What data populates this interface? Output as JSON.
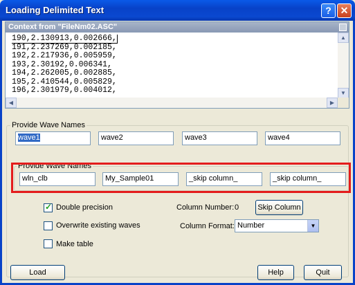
{
  "window": {
    "title": "Loading Delimited Text",
    "help_glyph": "?",
    "close_glyph": "✕"
  },
  "context": {
    "header": "Context from \"FileNm02.ASC\"",
    "lines": [
      "190,2.130913,0.002666,",
      "191,2.237269,0.002185,",
      "192,2.217936,0.005959,",
      "193,2.30192,0.006341,",
      "194,2.262005,0.002885,",
      "195,2.410544,0.005829,",
      "196,2.301979,0.004012,"
    ]
  },
  "wave_names_1": {
    "label": "Provide Wave Names",
    "fields": [
      "wave1",
      "wave2",
      "wave3",
      "wave4"
    ]
  },
  "wave_names_2": {
    "label": "Provide Wave Names",
    "fields": [
      "wln_clb",
      "My_Sample01",
      "_skip column_",
      "_skip column_"
    ]
  },
  "options": {
    "double_precision": {
      "label": "Double precision",
      "checked": true
    },
    "overwrite": {
      "label": "Overwrite existing waves",
      "checked": false
    },
    "make_table": {
      "label": "Make table",
      "checked": false
    }
  },
  "column": {
    "number_label": "Column Number:",
    "number_value": "0",
    "skip_button": "Skip Column",
    "format_label": "Column Format:",
    "format_value": "Number"
  },
  "buttons": {
    "load": "Load",
    "help": "Help",
    "quit": "Quit"
  },
  "colors": {
    "highlight": "#e41c1c",
    "title_bar": "#0842c8"
  }
}
